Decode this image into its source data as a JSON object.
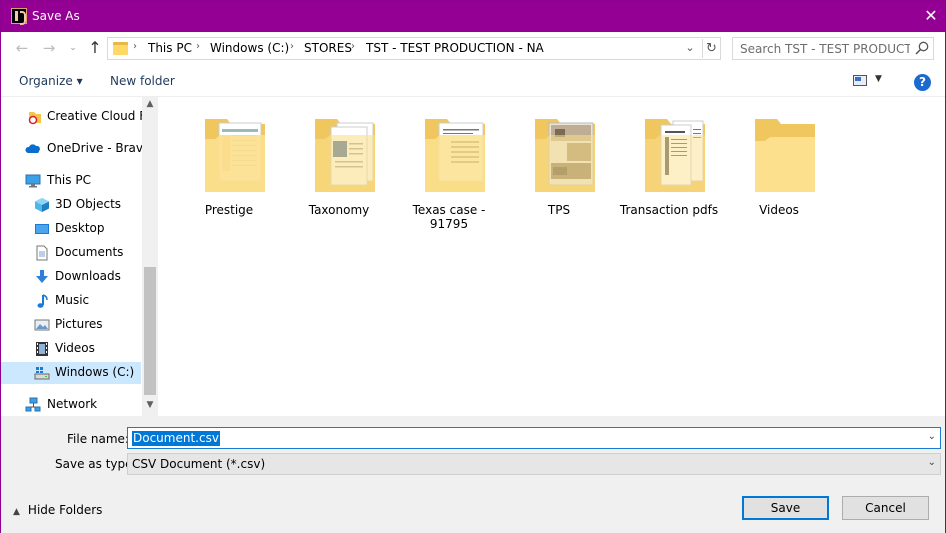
{
  "window": {
    "title": "Save As",
    "close_glyph": "✕",
    "titlebar_color": "#930093"
  },
  "address_bar": {
    "back_glyph": "←",
    "forward_glyph": "→",
    "recent_glyph": "⌄",
    "up_glyph": "↑",
    "crumbs": [
      "This PC",
      "Windows (C:)",
      "STORES",
      "TST - TEST PRODUCTION - NA"
    ],
    "separator": "›",
    "dropdown_glyph": "⌄",
    "refresh_glyph": "↻",
    "search_placeholder": "Search TST - TEST PRODUCTIO..."
  },
  "toolbar": {
    "organize_label": "Organize ▾",
    "new_folder_label": "New folder",
    "view_dropdown_glyph": "▼",
    "help_glyph": "?"
  },
  "nav_pane": {
    "items": [
      {
        "label": "Creative Cloud Fil",
        "icon": "creative-cloud-icon"
      },
      {
        "label": "OneDrive - Bravo",
        "icon": "onedrive-icon"
      },
      {
        "label": "This PC",
        "icon": "this-pc-icon"
      },
      {
        "label": "3D Objects",
        "icon": "3d-objects-icon"
      },
      {
        "label": "Desktop",
        "icon": "desktop-icon"
      },
      {
        "label": "Documents",
        "icon": "documents-icon"
      },
      {
        "label": "Downloads",
        "icon": "downloads-icon"
      },
      {
        "label": "Music",
        "icon": "music-icon"
      },
      {
        "label": "Pictures",
        "icon": "pictures-icon"
      },
      {
        "label": "Videos",
        "icon": "videos-icon"
      },
      {
        "label": "Windows (C:)",
        "icon": "drive-icon",
        "selected": true
      },
      {
        "label": "Network",
        "icon": "network-icon"
      }
    ],
    "scroll_up_glyph": "▲",
    "scroll_down_glyph": "▼"
  },
  "content": {
    "folders": [
      {
        "name": "Prestige",
        "preview": "spreadsheet"
      },
      {
        "name": "Taxonomy",
        "preview": "word-doc"
      },
      {
        "name": "Texas case - 91795",
        "preview": "form-doc"
      },
      {
        "name": "TPS",
        "preview": "photos"
      },
      {
        "name": "Transaction pdfs",
        "preview": "pdf-pages"
      },
      {
        "name": "Videos",
        "preview": "empty"
      }
    ]
  },
  "bottom": {
    "file_name_label": "File name:",
    "file_name_value": "Document.csv",
    "save_as_type_label": "Save as type:",
    "save_as_type_value": "CSV Document (*.csv)",
    "combo_glyph": "⌄",
    "hide_folders_chevron": "▲",
    "hide_folders_label": "Hide Folders",
    "save_label": "Save",
    "cancel_label": "Cancel"
  }
}
